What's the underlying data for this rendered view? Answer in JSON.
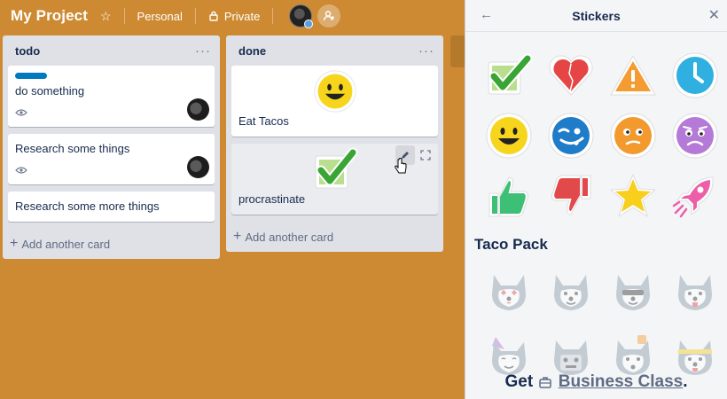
{
  "board": {
    "title": "My Project",
    "visibility_team": "Personal",
    "visibility_privacy": "Private"
  },
  "lists": [
    {
      "title": "todo",
      "cards": [
        {
          "title": "do something",
          "label_color": "#0079bf",
          "has_watch": true,
          "has_member": true
        },
        {
          "title": "Research some things",
          "has_watch": true,
          "has_member": true
        },
        {
          "title": "Research some more things"
        }
      ],
      "add_card": "Add another card"
    },
    {
      "title": "done",
      "cards": [
        {
          "title": "Eat Tacos",
          "sticker": "smiley"
        },
        {
          "title": "procrastinate",
          "sticker": "check"
        }
      ],
      "add_card": "Add another card"
    }
  ],
  "sidebar": {
    "title": "Stickers",
    "stickers": [
      "check",
      "heart",
      "warning",
      "clock",
      "smiley",
      "wink",
      "thinking",
      "frown",
      "thumbs-up",
      "thumbs-down",
      "star",
      "rocket"
    ],
    "taco_pack_title": "Taco Pack",
    "promo_prefix": "Get",
    "promo_link": "Business Class",
    "promo_suffix": "."
  },
  "colors": {
    "board_bg": "#ce8a33",
    "list_bg": "#dfe1e6",
    "sidebar_bg": "#f4f5f7"
  }
}
